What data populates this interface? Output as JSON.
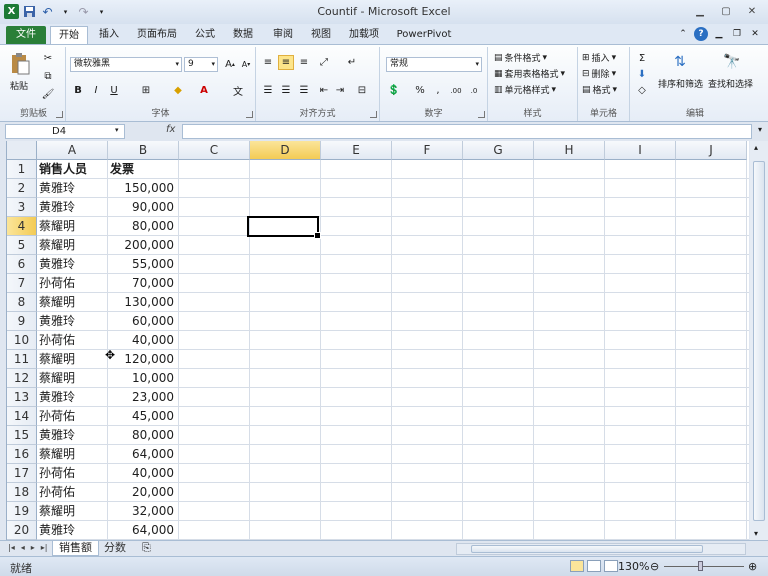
{
  "window": {
    "title": "Countif - Microsoft Excel"
  },
  "tabs": {
    "file": "文件",
    "home": "开始",
    "insert": "插入",
    "page_layout": "页面布局",
    "formulas": "公式",
    "data": "数据",
    "review": "审阅",
    "view": "视图",
    "addins": "加载项",
    "powerpivot": "PowerPivot"
  },
  "ribbon": {
    "clipboard": {
      "label": "剪贴板",
      "paste": "粘贴"
    },
    "font": {
      "label": "字体",
      "name": "微软雅黑",
      "size": "9"
    },
    "alignment": {
      "label": "对齐方式"
    },
    "number": {
      "label": "数字",
      "format": "常规"
    },
    "styles": {
      "label": "样式",
      "conditional": "条件格式",
      "as_table": "套用表格格式",
      "cell_styles": "单元格样式"
    },
    "cells": {
      "label": "单元格",
      "insert": "插入",
      "delete": "删除",
      "format": "格式"
    },
    "editing": {
      "label": "编辑",
      "sort": "排序和筛选",
      "find": "查找和选择"
    }
  },
  "formula_bar": {
    "name_box": "D4",
    "fx": "fx",
    "formula": ""
  },
  "sheet": {
    "columns": [
      "A",
      "B",
      "C",
      "D",
      "E",
      "F",
      "G",
      "H",
      "I",
      "J"
    ],
    "active_column": "D",
    "active_row": 4,
    "header": {
      "a": "销售人员",
      "b": "发票"
    },
    "rows": [
      {
        "a": "黄雅玲",
        "b": "150,000"
      },
      {
        "a": "黄雅玲",
        "b": "90,000"
      },
      {
        "a": "蔡耀明",
        "b": "80,000"
      },
      {
        "a": "蔡耀明",
        "b": "200,000"
      },
      {
        "a": "黄雅玲",
        "b": "55,000"
      },
      {
        "a": "孙荷佑",
        "b": "70,000"
      },
      {
        "a": "蔡耀明",
        "b": "130,000"
      },
      {
        "a": "黄雅玲",
        "b": "60,000"
      },
      {
        "a": "孙荷佑",
        "b": "40,000"
      },
      {
        "a": "蔡耀明",
        "b": "120,000"
      },
      {
        "a": "蔡耀明",
        "b": "10,000"
      },
      {
        "a": "黄雅玲",
        "b": "23,000"
      },
      {
        "a": "孙荷佑",
        "b": "45,000"
      },
      {
        "a": "黄雅玲",
        "b": "80,000"
      },
      {
        "a": "蔡耀明",
        "b": "64,000"
      },
      {
        "a": "孙荷佑",
        "b": "40,000"
      },
      {
        "a": "孙荷佑",
        "b": "20,000"
      },
      {
        "a": "蔡耀明",
        "b": "32,000"
      },
      {
        "a": "黄雅玲",
        "b": "64,000"
      }
    ]
  },
  "sheet_tabs": [
    "销售额",
    "分数"
  ],
  "status": {
    "text": "就绪",
    "zoom": "130%"
  }
}
